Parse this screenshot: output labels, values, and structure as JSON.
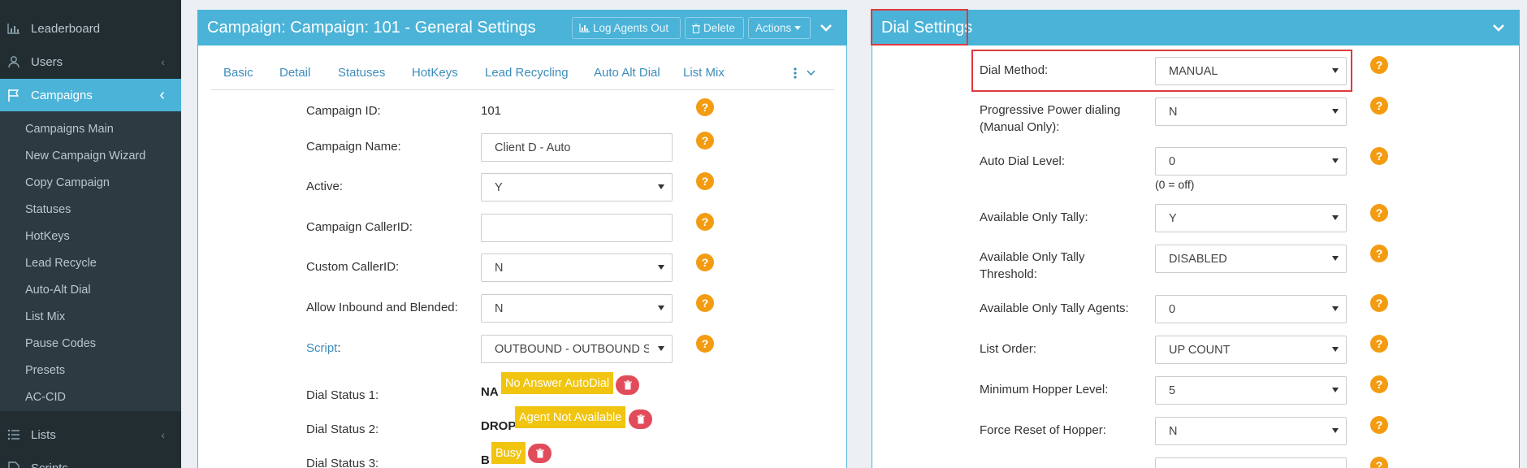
{
  "sidebar": {
    "items": [
      {
        "label": "Leaderboard",
        "icon": "bar-chart-icon"
      },
      {
        "label": "Users",
        "icon": "user-icon"
      },
      {
        "label": "Campaigns",
        "icon": "flag-icon"
      },
      {
        "label": "Lists",
        "icon": "list-icon"
      },
      {
        "label": "Scripts",
        "icon": "file-icon"
      }
    ],
    "subitems": [
      "Campaigns Main",
      "New Campaign Wizard",
      "Copy Campaign",
      "Statuses",
      "HotKeys",
      "Lead Recycle",
      "Auto-Alt Dial",
      "List Mix",
      "Pause Codes",
      "Presets",
      "AC-CID"
    ]
  },
  "left_panel": {
    "title": "Campaign: Campaign: 101 - General Settings",
    "buttons": {
      "log_agents_out": "Log Agents Out",
      "delete": "Delete",
      "actions": "Actions"
    },
    "tabs": [
      "Basic",
      "Detail",
      "Statuses",
      "HotKeys",
      "Lead Recycling",
      "Auto Alt Dial",
      "List Mix"
    ],
    "fields": {
      "campaign_id": {
        "label": "Campaign ID:",
        "value": "101"
      },
      "campaign_name": {
        "label": "Campaign Name:",
        "value": "Client D - Auto"
      },
      "active": {
        "label": "Active:",
        "value": "Y"
      },
      "campaign_callerid": {
        "label": "Campaign CallerID:",
        "value": ""
      },
      "custom_callerid": {
        "label": "Custom CallerID:",
        "value": "N"
      },
      "allow_inbound": {
        "label": "Allow Inbound and Blended:",
        "value": "N"
      },
      "script": {
        "label": "Script",
        "colon": ":",
        "value": "OUTBOUND - OUTBOUND SCRIPT"
      }
    },
    "dial_statuses": [
      {
        "label": "Dial Status 1:",
        "code": "NA",
        "name": "No Answer AutoDial"
      },
      {
        "label": "Dial Status 2:",
        "code": "DROP",
        "name": "Agent Not Available"
      },
      {
        "label": "Dial Status 3:",
        "code": "B",
        "name": "Busy"
      }
    ],
    "help_glyph": "?"
  },
  "right_panel": {
    "title": "Dial Settings",
    "fields": {
      "dial_method": {
        "label": "Dial Method:",
        "value": "MANUAL"
      },
      "progressive": {
        "label_1": "Progressive Power dialing",
        "label_2": "(Manual Only):",
        "value": "N"
      },
      "auto_dial_level": {
        "label": "Auto Dial Level:",
        "value": "0",
        "hint": "(0 = off)"
      },
      "available_only_tally": {
        "label": "Available Only Tally:",
        "value": "Y"
      },
      "tally_threshold": {
        "label_1": "Available Only Tally",
        "label_2": "Threshold:",
        "value": "DISABLED"
      },
      "tally_agents": {
        "label": "Available Only Tally Agents:",
        "value": "0"
      },
      "list_order": {
        "label": "List Order:",
        "value": "UP COUNT"
      },
      "min_hopper": {
        "label": "Minimum Hopper Level:",
        "value": "5"
      },
      "force_reset": {
        "label": "Force Reset of Hopper:",
        "value": "N"
      }
    }
  },
  "colors": {
    "accent": "#4bb3d8",
    "sidebar": "#222d32",
    "help": "#f39c12",
    "tag": "#f1c40f",
    "danger": "#e24c5a",
    "highlight": "#e0393e"
  }
}
